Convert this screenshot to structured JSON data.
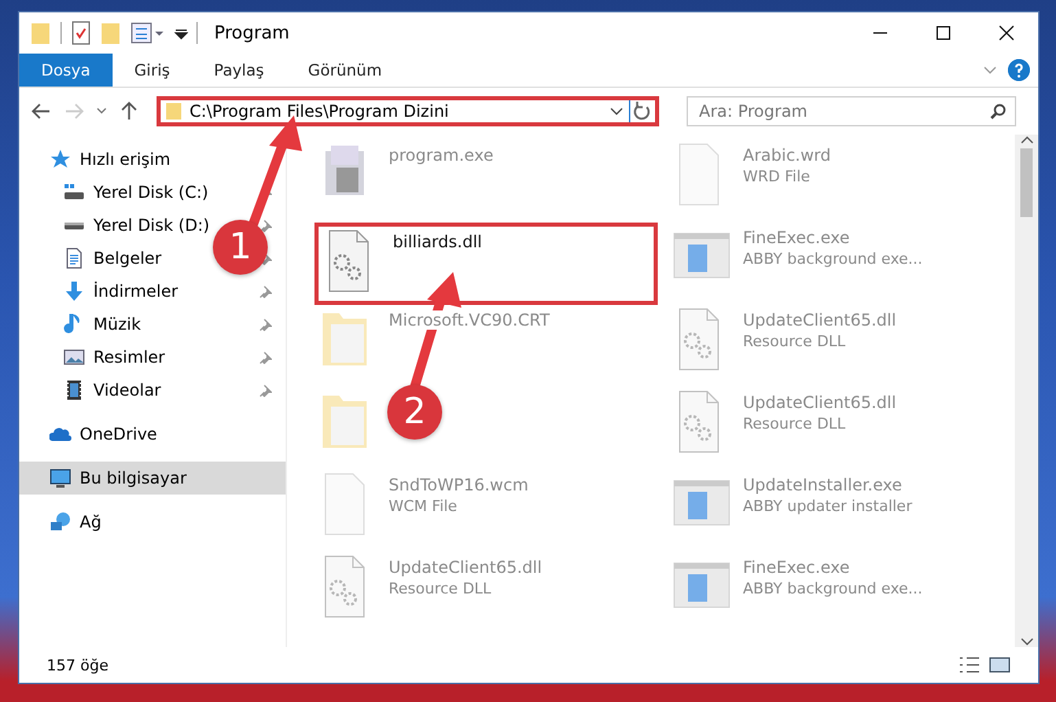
{
  "window": {
    "title": "Program"
  },
  "ribbon": {
    "tabs": [
      {
        "label": "Dosya",
        "selected": true
      },
      {
        "label": "Giriş",
        "selected": false
      },
      {
        "label": "Paylaş",
        "selected": false
      },
      {
        "label": "Görünüm",
        "selected": false
      }
    ]
  },
  "address": {
    "path": "C:\\Program Files\\Program Dizini",
    "highlighted": true
  },
  "search": {
    "placeholder": "Ara: Program"
  },
  "sidebar": {
    "items": [
      {
        "label": "Hızlı erişim",
        "kind": "star",
        "selected": false,
        "children": [
          {
            "label": "Yerel Disk (C:)",
            "kind": "drive-win",
            "pinned": true,
            "selected": false
          },
          {
            "label": "Yerel Disk (D:)",
            "kind": "drive",
            "pinned": true,
            "selected": false
          },
          {
            "label": "Belgeler",
            "kind": "document",
            "pinned": true,
            "selected": false
          },
          {
            "label": "İndirmeler",
            "kind": "download",
            "pinned": true,
            "selected": false
          },
          {
            "label": "Müzik",
            "kind": "music",
            "pinned": true,
            "selected": false
          },
          {
            "label": "Resimler",
            "kind": "picture",
            "pinned": true,
            "selected": false
          },
          {
            "label": "Videolar",
            "kind": "video",
            "pinned": true,
            "selected": false
          }
        ]
      },
      {
        "label": "OneDrive",
        "kind": "cloud",
        "selected": false
      },
      {
        "label": "Bu bilgisayar",
        "kind": "computer",
        "selected": true
      },
      {
        "label": "Ağ",
        "kind": "network",
        "selected": false
      }
    ]
  },
  "files": [
    {
      "name": "program.exe",
      "kind": "installer",
      "blurred": true,
      "highlighted": false
    },
    {
      "name": "Arabic.wrd",
      "type": "WRD File",
      "kind": "blank",
      "blurred": true,
      "highlighted": false
    },
    {
      "name": "billiards.dll",
      "kind": "dll",
      "blurred": false,
      "highlighted": true
    },
    {
      "name": "FineExec.exe",
      "type": "ABBY background exe...",
      "kind": "app",
      "blurred": true,
      "highlighted": false
    },
    {
      "name": "Microsoft.VC90.CRT",
      "kind": "folder",
      "blurred": true,
      "highlighted": false
    },
    {
      "name": "UpdateClient65.dll",
      "type": "Resource DLL",
      "kind": "dll",
      "blurred": true,
      "highlighted": false
    },
    {
      "kind": "folder",
      "blurred": true,
      "highlighted": false
    },
    {
      "name": "UpdateClient65.dll",
      "type": "Resource DLL",
      "kind": "dll",
      "blurred": true,
      "highlighted": false
    },
    {
      "name": "SndToWP16.wcm",
      "type": "WCM File",
      "kind": "blank",
      "blurred": true,
      "highlighted": false
    },
    {
      "name": "UpdateInstaller.exe",
      "type": "ABBY updater installer",
      "kind": "app",
      "blurred": true,
      "highlighted": false
    },
    {
      "name": "UpdateClient65.dll",
      "type": "Resource DLL",
      "kind": "dll",
      "blurred": true,
      "highlighted": false
    },
    {
      "name": "FineExec.exe",
      "type": "ABBY background exe...",
      "kind": "app",
      "blurred": true,
      "highlighted": false
    }
  ],
  "status_bar": {
    "count": "157 öğe"
  },
  "annotations": [
    {
      "number": "1"
    },
    {
      "number": "2"
    }
  ]
}
